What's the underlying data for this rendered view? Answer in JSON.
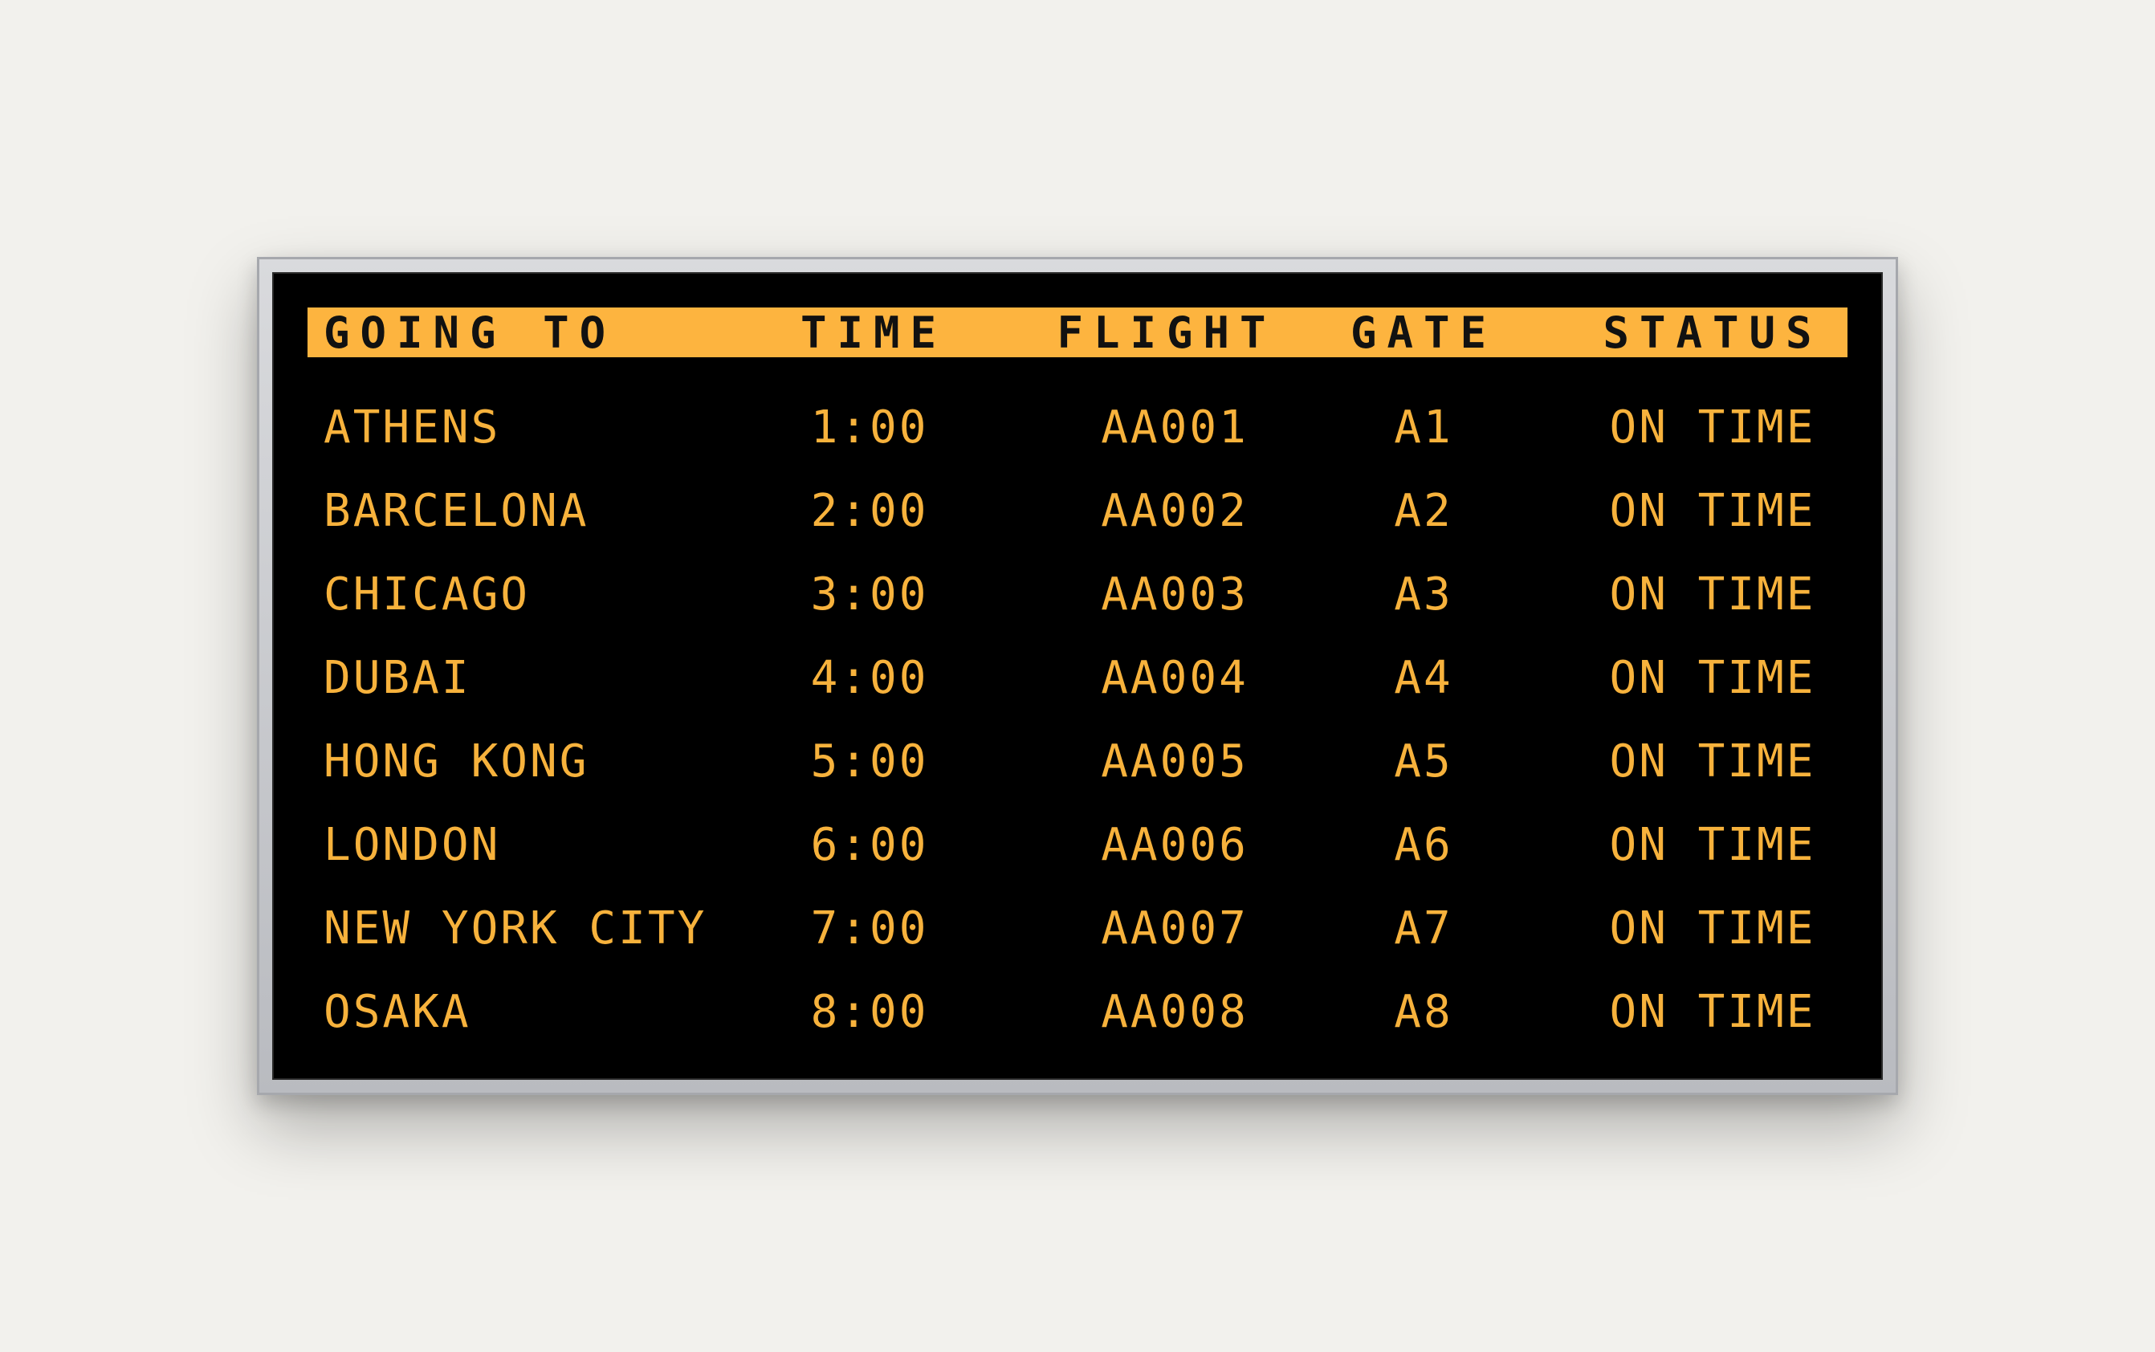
{
  "colors": {
    "background": "#f2f1ed",
    "board": "#000000",
    "accent": "#fdb43f",
    "text": "#f7b23c",
    "header_text": "#111111",
    "frame": "#c4c6ca"
  },
  "header": {
    "destination": "GOING TO",
    "time": "TIME",
    "flight": "FLIGHT",
    "gate": "GATE",
    "status": "STATUS"
  },
  "flights": [
    {
      "destination": "ATHENS",
      "time": "1:00",
      "flight": "AA001",
      "gate": "A1",
      "status": "ON TIME"
    },
    {
      "destination": "BARCELONA",
      "time": "2:00",
      "flight": "AA002",
      "gate": "A2",
      "status": "ON TIME"
    },
    {
      "destination": "CHICAGO",
      "time": "3:00",
      "flight": "AA003",
      "gate": "A3",
      "status": "ON TIME"
    },
    {
      "destination": "DUBAI",
      "time": "4:00",
      "flight": "AA004",
      "gate": "A4",
      "status": "ON TIME"
    },
    {
      "destination": "HONG KONG",
      "time": "5:00",
      "flight": "AA005",
      "gate": "A5",
      "status": "ON TIME"
    },
    {
      "destination": "LONDON",
      "time": "6:00",
      "flight": "AA006",
      "gate": "A6",
      "status": "ON TIME"
    },
    {
      "destination": "NEW YORK CITY",
      "time": "7:00",
      "flight": "AA007",
      "gate": "A7",
      "status": "ON TIME"
    },
    {
      "destination": "OSAKA",
      "time": "8:00",
      "flight": "AA008",
      "gate": "A8",
      "status": "ON TIME"
    }
  ]
}
